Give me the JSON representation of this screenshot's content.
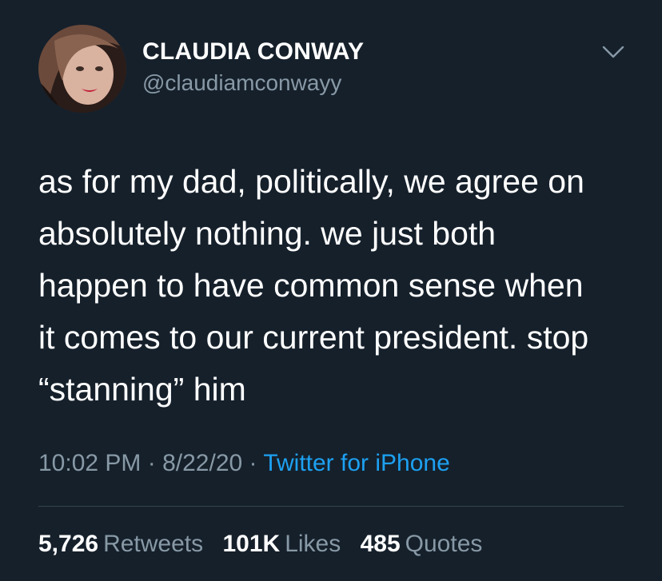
{
  "author": {
    "display_name": "CLAUDIA CONWAY",
    "handle": "@claudiamconwayy"
  },
  "icons": {
    "more": "chevron-down-icon",
    "avatar": "profile-photo"
  },
  "tweet": {
    "lines": [
      "as for my dad, politically, we agree on",
      "absolutely nothing. we just both",
      "happen to have common sense when",
      "it comes to our current president. stop",
      "“stanning” him"
    ]
  },
  "meta": {
    "time": "10:02 PM",
    "separator": " · ",
    "date": "8/22/20",
    "source": "Twitter for iPhone"
  },
  "stats": {
    "retweets": {
      "count": "5,726",
      "label": "Retweets"
    },
    "likes": {
      "count": "101K",
      "label": "Likes"
    },
    "quotes": {
      "count": "485",
      "label": "Quotes"
    }
  },
  "colors": {
    "background": "#15202b",
    "secondary_text": "#8899a6",
    "link": "#1da1f2",
    "divider": "#38444d"
  }
}
